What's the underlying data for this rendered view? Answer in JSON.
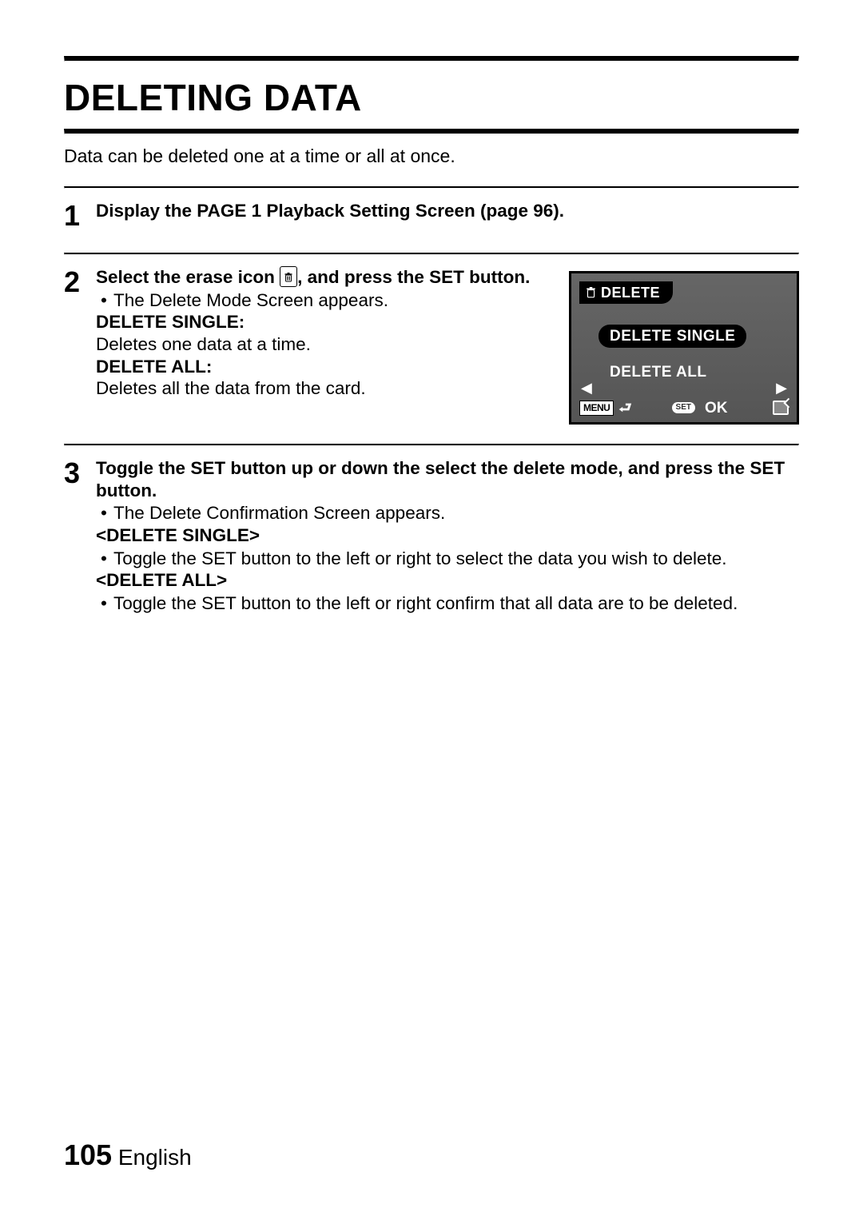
{
  "title": "DELETING DATA",
  "intro": "Data can be deleted one at a time or all at once.",
  "steps": {
    "s1": {
      "num": "1",
      "text": "Display the PAGE 1 Playback Setting Screen (page 96)."
    },
    "s2": {
      "num": "2",
      "lead_a": "Select the erase icon ",
      "lead_b": ", and press the SET button.",
      "bullet1": "The Delete Mode Screen appears.",
      "ds_label": "DELETE SINGLE:",
      "ds_desc": "Deletes one data at a time.",
      "da_label": "DELETE ALL:",
      "da_desc": "Deletes all the data from the card."
    },
    "s3": {
      "num": "3",
      "lead": "Toggle the SET button up or down the select the delete mode, and press the SET button.",
      "bullet1": "The Delete Confirmation Screen appears.",
      "ds_label": "<DELETE SINGLE>",
      "ds_bullet": "Toggle the SET button to the left or right to select the data you wish to delete.",
      "da_label": "<DELETE ALL>",
      "da_bullet": "Toggle the SET button to the left or right confirm that all data are to be deleted."
    }
  },
  "screen": {
    "tab": "DELETE",
    "opt1": "DELETE SINGLE",
    "opt2": "DELETE ALL",
    "menu": "MENU",
    "set": "SET",
    "ok": "OK"
  },
  "footer": {
    "page": "105",
    "lang": "English"
  }
}
